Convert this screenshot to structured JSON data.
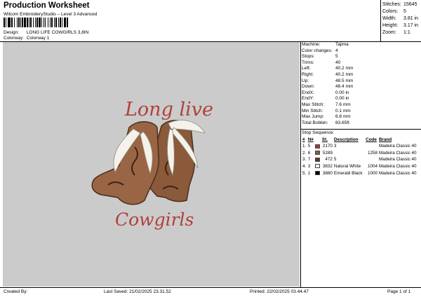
{
  "header": {
    "title": "Production Worksheet",
    "subtitle": "Wilcom EmbroideryStudio – Level 3 Advanced",
    "design_label": "Design:",
    "design_value": "LONG LIFE COWGIRLS 3,8IN",
    "colorway_label": "Colorway:",
    "colorway_value": "Colorway 1"
  },
  "stats": [
    {
      "label": "Stitches:",
      "value": "15645"
    },
    {
      "label": "Colors:",
      "value": "5"
    },
    {
      "label": "Width:",
      "value": "3.81 in"
    },
    {
      "label": "Height:",
      "value": "3.17 in"
    },
    {
      "label": "Zoom:",
      "value": "1:1"
    }
  ],
  "machine_info": [
    {
      "label": "Machine:",
      "value": "Tajima"
    },
    {
      "label": "Color changes:",
      "value": "4"
    },
    {
      "label": "Stops:",
      "value": "5"
    },
    {
      "label": "Trims:",
      "value": "40"
    },
    {
      "label": "Left:",
      "value": "40.2 mm"
    },
    {
      "label": "Right:",
      "value": "40.2 mm"
    },
    {
      "label": "Up:",
      "value": "48.5 mm"
    },
    {
      "label": "Down:",
      "value": "48.4 mm"
    },
    {
      "label": "EndX:",
      "value": "0.00 in"
    },
    {
      "label": "EndY:",
      "value": "0.00 in"
    },
    {
      "label": "Max Stitch:",
      "value": "7.6 mm"
    },
    {
      "label": "Min Stitch:",
      "value": "0.1 mm"
    },
    {
      "label": "Max Jump:",
      "value": "6.8 mm"
    },
    {
      "label": "Total Bobbin:",
      "value": "83.65ft"
    }
  ],
  "stop_sequence": {
    "title": "Stop Sequence:",
    "headers": [
      "#",
      "N#",
      "",
      "St.",
      "Description",
      "Code",
      "Brand"
    ],
    "rows": [
      {
        "idx": "1.",
        "n": "5",
        "color": "#a33a36",
        "st": "2170",
        "desc": "3",
        "code": "",
        "brand": "Madeira Classic 40"
      },
      {
        "idx": "2.",
        "n": "6",
        "color": "#8a5a4a",
        "st": "5289",
        "desc": "",
        "code": "1258",
        "brand": "Madeira Classic 40"
      },
      {
        "idx": "3.",
        "n": "7",
        "color": "#5c3b2a",
        "st": "472",
        "desc": "5",
        "code": "",
        "brand": "Madeira Classic 40"
      },
      {
        "idx": "4.",
        "n": "3",
        "color": "#f4f2ea",
        "st": "3832",
        "desc": "Natural White",
        "code": "1004",
        "brand": "Madeira Classic 40"
      },
      {
        "idx": "5.",
        "n": "1",
        "color": "#000000",
        "st": "3880",
        "desc": "Emerald Black",
        "code": "1000",
        "brand": "Madeira Classic 40"
      }
    ]
  },
  "preview": {
    "text_top": "Long live",
    "text_bottom": "Cowgirls",
    "text_color": "#b0413b"
  },
  "footer": {
    "created_by": "Created By:",
    "last_saved": "Last Saved: 21/02/2025 23.31.52",
    "printed": "Printed: 22/02/2025 03.44.47",
    "page": "Page 1 of 1"
  }
}
